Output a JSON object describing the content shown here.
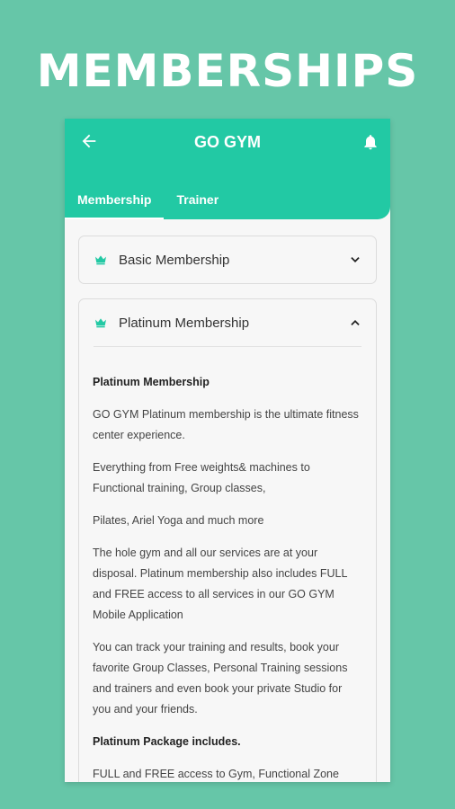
{
  "promo": {
    "title": "MEMBERSHIPS"
  },
  "appbar": {
    "title": "GO GYM",
    "back_icon": "arrow-left-icon",
    "bell_icon": "bell-icon",
    "color": "#22c9a4"
  },
  "tabs": [
    {
      "label": "Membership",
      "active": true
    },
    {
      "label": "Trainer",
      "active": false
    }
  ],
  "cards": {
    "basic": {
      "title": "Basic Membership",
      "expanded": false
    },
    "platinum": {
      "title": "Platinum Membership",
      "expanded": true,
      "heading": "Platinum Membership",
      "paragraphs": [
        "GO GYM Platinum membership is the ultimate fitness center experience.",
        "Everything from Free weights& machines to Functional training, Group classes,",
        "Pilates, Ariel Yoga and much more",
        "The hole gym and all our services are at your disposal. Platinum membership also includes FULL and FREE access to all services in our GO GYM Mobile Application",
        "You can track your training and results, book your favorite Group Classes, Personal Training sessions and trainers and even book your private Studio for you and your friends."
      ],
      "package_heading": "Platinum Package includes.",
      "package_first": "FULL and FREE access to Gym, Functional Zone"
    }
  },
  "colors": {
    "background": "#66c6a8",
    "accent": "#22c9a4"
  }
}
